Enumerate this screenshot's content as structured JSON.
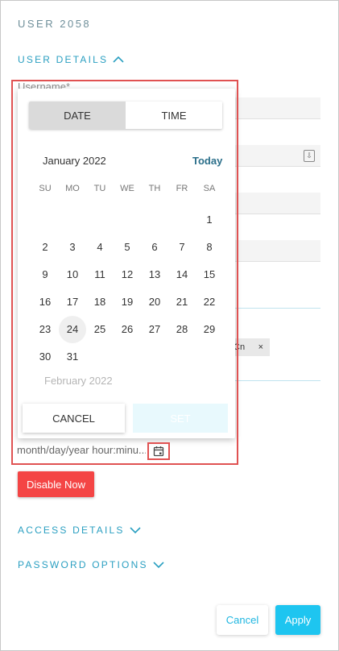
{
  "title": "USER 2058",
  "sections": {
    "user_details": "USER DETAILS",
    "access_details": "ACCESS DETAILS",
    "password_options": "PASSWORD OPTIONS"
  },
  "username_label": "Username*",
  "chip_text": "Cn",
  "chip_close": "×",
  "picker": {
    "tabs": [
      "DATE",
      "TIME"
    ],
    "active_tab": "DATE",
    "month_title": "January 2022",
    "today_label": "Today",
    "weekdays": [
      "SU",
      "MO",
      "TU",
      "WE",
      "TH",
      "FR",
      "SA"
    ],
    "days": [
      "1",
      "2",
      "3",
      "4",
      "5",
      "6",
      "7",
      "8",
      "9",
      "10",
      "11",
      "12",
      "13",
      "14",
      "15",
      "16",
      "17",
      "18",
      "19",
      "20",
      "21",
      "22",
      "23",
      "24",
      "25",
      "26",
      "27",
      "28",
      "29",
      "30",
      "31"
    ],
    "selected_day": "24",
    "next_month_title": "February 2022",
    "cancel_label": "CANCEL",
    "set_label": "SET"
  },
  "datetime_input": {
    "placeholder": "month/day/year hour:minu..."
  },
  "disable_now_label": "Disable Now",
  "footer": {
    "cancel_label": "Cancel",
    "apply_label": "Apply"
  },
  "colors": {
    "accent": "#1ec5f0",
    "danger": "#f44545",
    "section": "#2a9fc1"
  }
}
